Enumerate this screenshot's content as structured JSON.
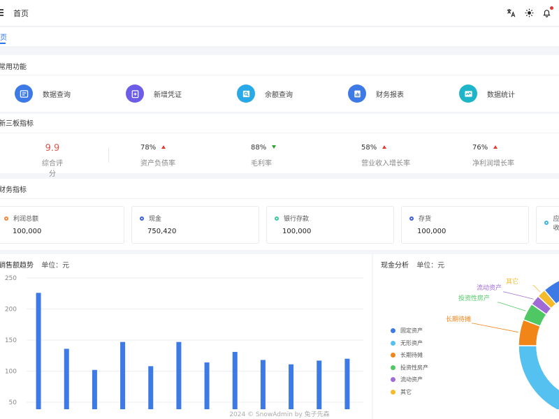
{
  "header": {
    "breadcrumb": "首页",
    "icons": [
      "translate-icon",
      "theme-sun-icon",
      "notification-bell-icon"
    ]
  },
  "tabs": {
    "active_label": "页"
  },
  "shortcuts": {
    "title": "常用功能",
    "items": [
      {
        "label": "数据查询",
        "icon": "data-query-icon",
        "color": "#3d7ae6"
      },
      {
        "label": "新增凭证",
        "icon": "add-voucher-icon",
        "color": "#6c5ce7"
      },
      {
        "label": "余额查询",
        "icon": "balance-query-icon",
        "color": "#29a9e8"
      },
      {
        "label": "财务报表",
        "icon": "financial-report-icon",
        "color": "#3d7ae6"
      },
      {
        "label": "数据统计",
        "icon": "data-statistics-icon",
        "color": "#1fb5c9"
      }
    ]
  },
  "neeq": {
    "title": "新三板指标",
    "score": {
      "value": "9.9",
      "label": "综合评分",
      "color": "#e0574f"
    },
    "metrics": [
      {
        "value": "78%",
        "label": "资产负债率",
        "trend": "up"
      },
      {
        "value": "88%",
        "label": "毛利率",
        "trend": "down"
      },
      {
        "value": "58%",
        "label": "营业收入增长率",
        "trend": "up"
      },
      {
        "value": "76%",
        "label": "净利润增长率",
        "trend": "up"
      }
    ]
  },
  "finance": {
    "title": "财务指标",
    "cards": [
      {
        "name": "利润总额",
        "amount": "100,000",
        "color": "#f0883e"
      },
      {
        "name": "现金",
        "amount": "750,420",
        "color": "#3d5fd9"
      },
      {
        "name": "银行存款",
        "amount": "100,000",
        "color": "#3cc8a0"
      },
      {
        "name": "存货",
        "amount": "100,000",
        "color": "#3d5fd9"
      },
      {
        "name": "应收",
        "amount": "",
        "color": "#3bb4e6"
      }
    ]
  },
  "sales_chart": {
    "title": "销售额趋势",
    "unit": "单位：元"
  },
  "cash_chart": {
    "title": "现金分析",
    "unit": "单位：元"
  },
  "chart_data": [
    {
      "type": "bar",
      "title": "销售额趋势",
      "ylim": [
        0,
        250
      ],
      "yticks": [
        50,
        100,
        150,
        200,
        250
      ],
      "grid": true,
      "color": "#3d7ae6",
      "values": [
        226,
        136,
        102,
        147,
        108,
        147,
        114,
        131,
        118,
        111,
        117,
        120
      ]
    },
    {
      "type": "pie",
      "title": "现金分析",
      "legend_position": "left",
      "slices": [
        {
          "name": "固定资产",
          "color": "#3d7ae6"
        },
        {
          "name": "无形资产",
          "color": "#55c1f0",
          "value": 48
        },
        {
          "name": "长期待摊",
          "color": "#f28518",
          "value": 12
        },
        {
          "name": "投资性房产",
          "color": "#4fc864",
          "value": 8
        },
        {
          "name": "流动资产",
          "color": "#a16bd6",
          "value": 5
        },
        {
          "name": "其它",
          "color": "#f4bc2b",
          "value": 4
        }
      ]
    }
  ],
  "footer": {
    "text": "2024 © SnowAdmin by 兔子先森"
  }
}
